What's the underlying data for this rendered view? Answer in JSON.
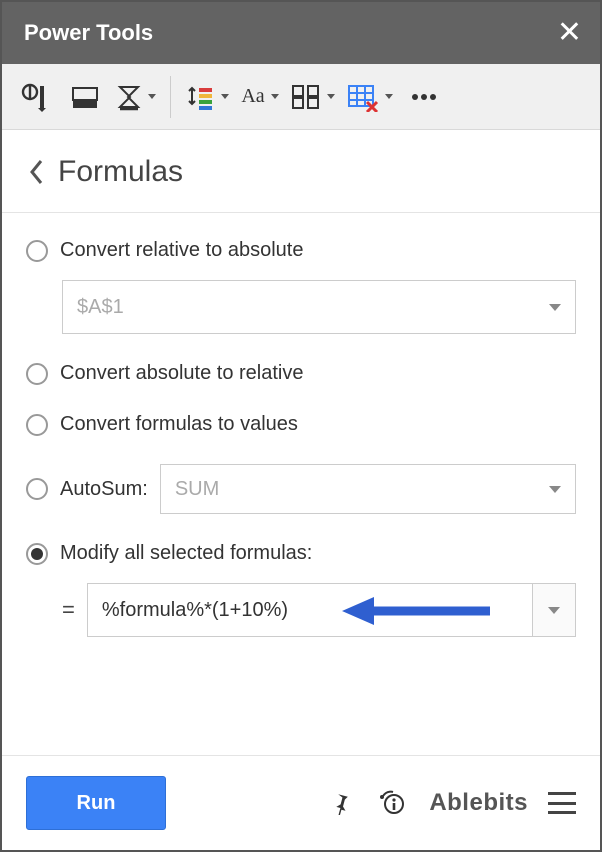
{
  "titlebar": {
    "title": "Power Tools"
  },
  "breadcrumb": {
    "title": "Formulas"
  },
  "options": {
    "convert_rel_to_abs": {
      "label": "Convert relative to absolute",
      "value": "$A$1",
      "selected": false
    },
    "convert_abs_to_rel": {
      "label": "Convert absolute to relative",
      "selected": false
    },
    "convert_to_values": {
      "label": "Convert formulas to values",
      "selected": false
    },
    "autosum": {
      "label": "AutoSum:",
      "value": "SUM",
      "selected": false
    },
    "modify": {
      "label": "Modify all selected formulas:",
      "eq": "=",
      "value": "%formula%*(1+10%)",
      "selected": true
    }
  },
  "footer": {
    "run": "Run",
    "brand": "Ablebits"
  }
}
